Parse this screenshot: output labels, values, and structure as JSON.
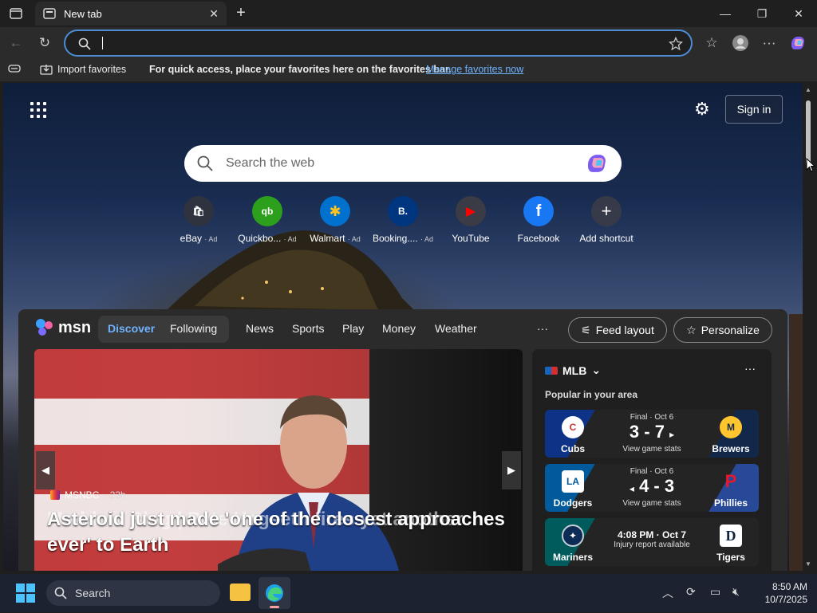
{
  "browser": {
    "tab_title": "New tab",
    "favorites_bar": {
      "import_label": "Import favorites",
      "message": "For quick access, place your favorites here on the favorites bar.",
      "manage_link": "Manage favorites now"
    }
  },
  "newtab": {
    "signin_label": "Sign in",
    "search_placeholder": "Search the web",
    "shortcuts": [
      {
        "label": "eBay",
        "ad": "· Ad",
        "glyph": "🛍"
      },
      {
        "label": "Quickbo...",
        "ad": "· Ad",
        "glyph": "qb"
      },
      {
        "label": "Walmart",
        "ad": "· Ad",
        "glyph": "✱"
      },
      {
        "label": "Booking....",
        "ad": "· Ad",
        "glyph": "B."
      },
      {
        "label": "YouTube",
        "ad": "",
        "glyph": "▶"
      },
      {
        "label": "Facebook",
        "ad": "",
        "glyph": "f"
      },
      {
        "label": "Add shortcut",
        "ad": "",
        "glyph": "+"
      }
    ]
  },
  "msn": {
    "logo": "msn",
    "tabs": {
      "discover": "Discover",
      "following": "Following"
    },
    "nav": [
      "News",
      "Sports",
      "Play",
      "Money",
      "Weather"
    ],
    "more": "···",
    "feed_layout": "Feed layout",
    "personalize": "Personalize",
    "hero": {
      "source": "MSNBC",
      "time": "· 23h",
      "headline_front": "Asteroid just made 'one of the closest approaches ever' to Earth",
      "headline_back": "Maddow Blog | Pete Hegseth fires yet another"
    },
    "mlb": {
      "title": "MLB",
      "subtitle": "Popular in your area",
      "more": "···",
      "games": [
        {
          "home": "Cubs",
          "away": "Brewers",
          "status": "Final · Oct 6",
          "score": "3 - 7",
          "link": "View game stats",
          "home_color": "#0e3386",
          "away_color": "#12284b"
        },
        {
          "home": "Dodgers",
          "away": "Phillies",
          "status": "Final · Oct 6",
          "score": "4 - 3",
          "link": "View game stats",
          "home_color": "#005a9c",
          "away_color": "#e81828"
        },
        {
          "home": "Mariners",
          "away": "Tigers",
          "status": "4:08 PM · Oct 7",
          "score": "",
          "link": "Injury report available",
          "home_color": "#005c5c",
          "away_color": "#0c2340"
        }
      ]
    }
  },
  "taskbar": {
    "search_label": "Search",
    "time": "8:50 AM",
    "date": "10/7/2025"
  }
}
